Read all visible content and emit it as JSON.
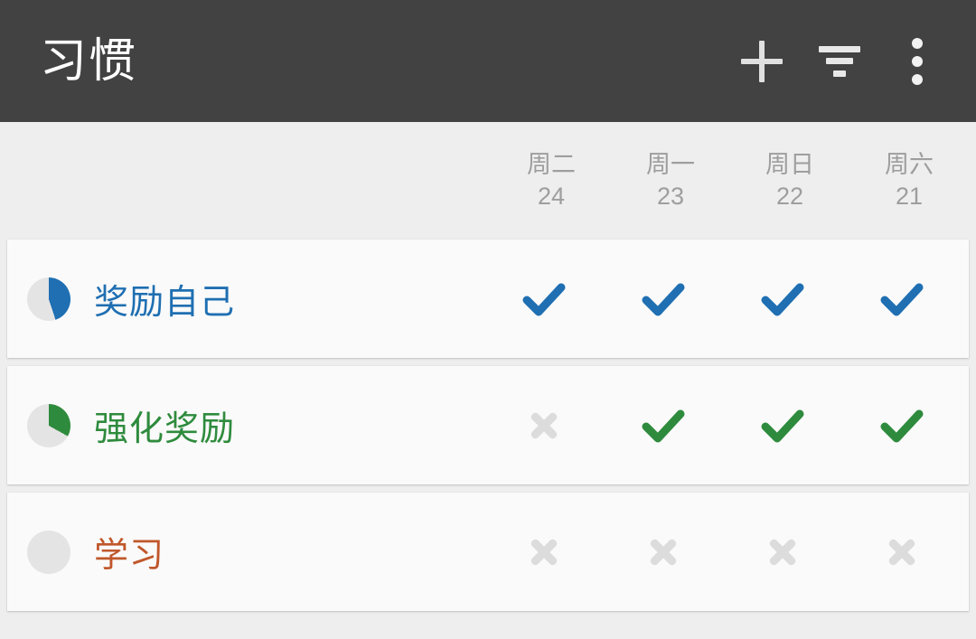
{
  "toolbar": {
    "title": "习惯",
    "actions": [
      {
        "name": "add-habit",
        "icon": "plus-icon"
      },
      {
        "name": "filter",
        "icon": "filter-icon"
      },
      {
        "name": "overflow-menu",
        "icon": "more-vertical-icon"
      }
    ]
  },
  "date_header": {
    "columns": [
      {
        "dow": "周二",
        "day": "24"
      },
      {
        "dow": "周一",
        "day": "23"
      },
      {
        "dow": "周日",
        "day": "22"
      },
      {
        "dow": "周六",
        "day": "21"
      }
    ]
  },
  "habits": [
    {
      "name": "奖励自己",
      "color": "#1f6fb2",
      "ring_percent": 45,
      "marks": [
        "check",
        "check",
        "check",
        "check"
      ]
    },
    {
      "name": "强化奖励",
      "color": "#2e8b3d",
      "ring_percent": 33,
      "marks": [
        "x",
        "check",
        "check",
        "check"
      ]
    },
    {
      "name": "学习",
      "color": "#c0572b",
      "ring_percent": 0,
      "marks": [
        "x",
        "x",
        "x",
        "x"
      ]
    }
  ],
  "colors": {
    "toolbar_bg": "#424242",
    "page_bg": "#eeeeee",
    "row_bg": "#fafafa",
    "date_text": "#9e9e9e",
    "ring_track": "#e4e4e4",
    "x_mark": "#dcdcdc",
    "title_text": "#ffffff"
  }
}
